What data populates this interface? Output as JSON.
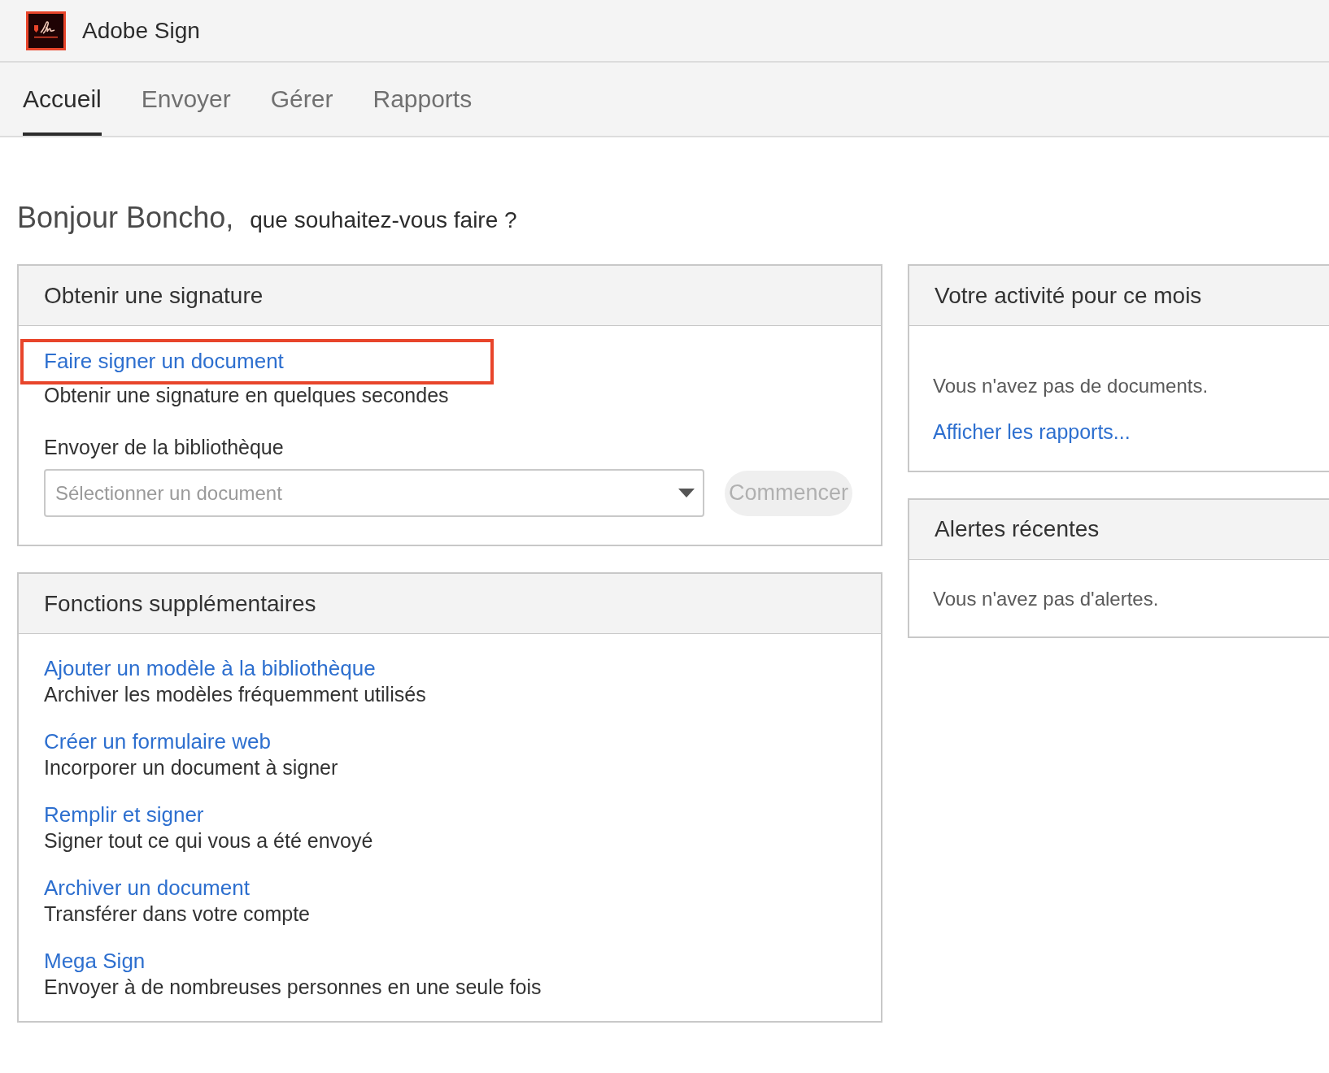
{
  "app": {
    "name": "Adobe Sign"
  },
  "tabs": [
    {
      "label": "Accueil",
      "selected": true
    },
    {
      "label": "Envoyer",
      "selected": false
    },
    {
      "label": "Gérer",
      "selected": false
    },
    {
      "label": "Rapports",
      "selected": false
    }
  ],
  "greeting": {
    "name": "Bonjour Boncho,",
    "question": "que souhaitez-vous faire ?"
  },
  "signature_card": {
    "title": "Obtenir une signature",
    "action": {
      "link": "Faire signer un document",
      "description": "Obtenir une signature en quelques secondes",
      "highlighted": true
    },
    "library": {
      "label": "Envoyer de la bibliothèque",
      "select": {
        "placeholder": "Sélectionner un document"
      },
      "button": {
        "label": "Commencer",
        "disabled": true
      }
    }
  },
  "features_card": {
    "title": "Fonctions supplémentaires",
    "items": [
      {
        "link": "Ajouter un modèle à la bibliothèque",
        "description": "Archiver les modèles fréquemment utilisés"
      },
      {
        "link": "Créer un formulaire web",
        "description": "Incorporer un document à signer"
      },
      {
        "link": "Remplir et signer",
        "description": "Signer tout ce qui vous a été envoyé"
      },
      {
        "link": "Archiver un document",
        "description": "Transférer dans votre compte"
      },
      {
        "link": "Mega Sign",
        "description": "Envoyer à de nombreuses personnes en une seule fois"
      }
    ]
  },
  "activity_card": {
    "title": "Votre activité pour ce mois",
    "message": "Vous n'avez pas de documents.",
    "link": "Afficher les rapports..."
  },
  "alerts_card": {
    "title": "Alertes récentes",
    "message": "Vous n'avez pas d'alertes."
  }
}
